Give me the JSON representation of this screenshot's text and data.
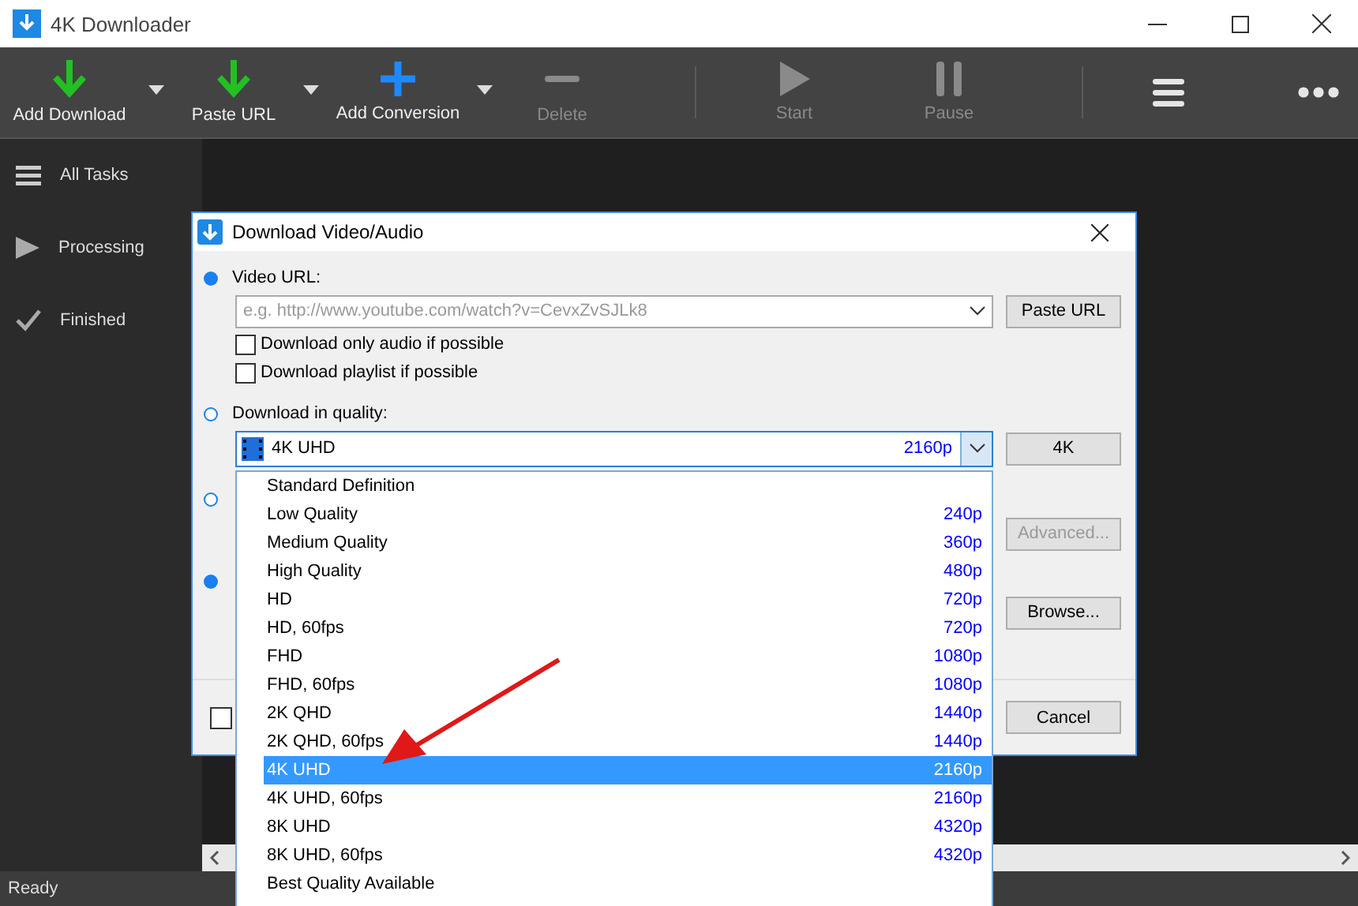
{
  "window": {
    "title": "4K Downloader"
  },
  "toolbar": [
    {
      "kind": "download",
      "label": "Add Download",
      "disabled": false,
      "menu": true
    },
    {
      "kind": "paste",
      "label": "Paste URL",
      "disabled": false,
      "menu": true
    },
    {
      "kind": "convert",
      "label": "Add Conversion",
      "disabled": false,
      "menu": true
    },
    {
      "kind": "delete",
      "label": "Delete",
      "disabled": true
    },
    {
      "kind": "separator"
    },
    {
      "kind": "start",
      "label": "Start",
      "disabled": true
    },
    {
      "kind": "pause",
      "label": "Pause",
      "disabled": true
    },
    {
      "kind": "separator"
    },
    {
      "kind": "menu"
    },
    {
      "kind": "more"
    }
  ],
  "sidebar": {
    "items": [
      {
        "kind": "all",
        "label": "All Tasks"
      },
      {
        "kind": "processing",
        "label": "Processing"
      },
      {
        "kind": "finished",
        "label": "Finished"
      }
    ]
  },
  "status_bar": "Ready",
  "dialog": {
    "title": "Download Video/Audio",
    "url_option": {
      "label": "Video URL:",
      "selected": true
    },
    "url_field": {
      "placeholder": "e.g. http://www.youtube.com/watch?v=CevxZvSJLk8"
    },
    "paste_button": "Paste URL",
    "checkboxes": [
      {
        "label": "Download only audio if possible",
        "checked": false
      },
      {
        "label": "Download playlist if possible",
        "checked": false
      }
    ],
    "quality_option": {
      "label": "Download in quality:",
      "selected": false
    },
    "quality_select": {
      "value": "4K UHD",
      "resolution": "2160p"
    },
    "quality_button": "4K",
    "hidden_options": [
      {
        "selected": false
      },
      {
        "selected": true
      }
    ],
    "advanced_button": {
      "label": "Advanced...",
      "disabled": true
    },
    "browse_button": "Browse...",
    "footer_checkbox": {
      "checked": false
    },
    "cancel_button": "Cancel"
  },
  "quality_list": [
    {
      "label": "Standard Definition",
      "selected": false
    },
    {
      "label": "Low Quality",
      "resolution": "240p",
      "selected": false
    },
    {
      "label": "Medium Quality",
      "resolution": "360p",
      "selected": false
    },
    {
      "label": "High Quality",
      "resolution": "480p",
      "selected": false
    },
    {
      "label": "HD",
      "resolution": "720p",
      "selected": false
    },
    {
      "label": "HD, 60fps",
      "resolution": "720p",
      "selected": false
    },
    {
      "label": "FHD",
      "resolution": "1080p",
      "selected": false
    },
    {
      "label": "FHD, 60fps",
      "resolution": "1080p",
      "selected": false
    },
    {
      "label": "2K QHD",
      "resolution": "1440p",
      "selected": false
    },
    {
      "label": "2K QHD, 60fps",
      "resolution": "1440p",
      "selected": false
    },
    {
      "label": "4K UHD",
      "resolution": "2160p",
      "selected": true
    },
    {
      "label": "4K UHD, 60fps",
      "resolution": "2160p",
      "selected": false
    },
    {
      "label": "8K UHD",
      "resolution": "4320p",
      "selected": false
    },
    {
      "label": "8K UHD, 60fps",
      "resolution": "4320p",
      "selected": false
    },
    {
      "label": "Best Quality Available",
      "selected": false
    }
  ]
}
